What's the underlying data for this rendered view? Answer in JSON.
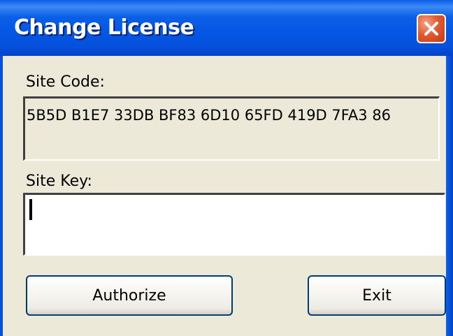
{
  "window": {
    "title": "Change License"
  },
  "titlebar": {
    "close_icon": "close-x-icon",
    "close_color": "#e25a32"
  },
  "site_code": {
    "label": "Site Code:",
    "value": "5B5D B1E7 33DB BF83 6D10 65FD 419D 7FA3 86"
  },
  "site_key": {
    "label": "Site Key:",
    "value": "",
    "placeholder": ""
  },
  "buttons": {
    "authorize_label": "Authorize",
    "exit_label": "Exit"
  },
  "colors": {
    "titlebar_blue": "#0456e4",
    "dialog_background": "#ece9d8",
    "button_border": "#003c74"
  }
}
